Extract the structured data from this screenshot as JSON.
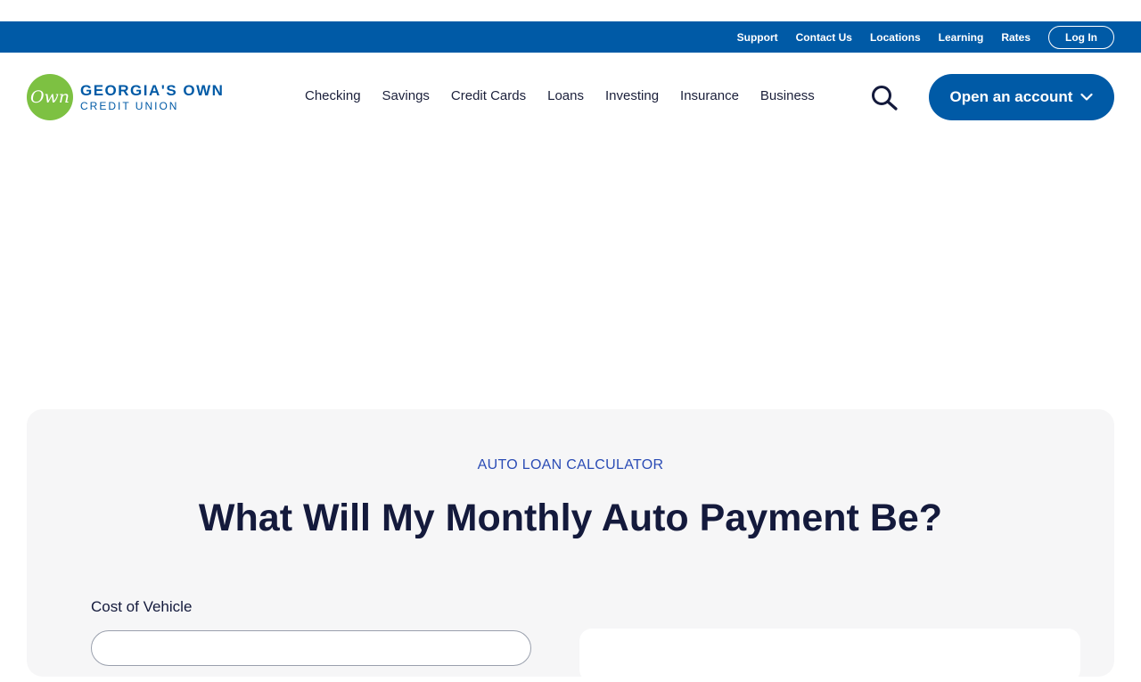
{
  "utility_nav": {
    "links": [
      "Support",
      "Contact Us",
      "Locations",
      "Learning",
      "Rates"
    ],
    "login_label": "Log In"
  },
  "brand": {
    "logo_mark": "Own",
    "name_line1": "GEORGIA'S OWN",
    "name_line2": "CREDIT UNION",
    "colors": {
      "primary": "#005aa6",
      "logo_green": "#7dc142",
      "heading": "#141a3c",
      "eyebrow": "#2b4cb5"
    }
  },
  "main_nav": {
    "items": [
      "Checking",
      "Savings",
      "Credit Cards",
      "Loans",
      "Investing",
      "Insurance",
      "Business"
    ],
    "search_icon": "search-icon",
    "cta_label": "Open an account",
    "cta_icon": "chevron-down-icon"
  },
  "calculator": {
    "eyebrow": "AUTO LOAN CALCULATOR",
    "title": "What Will My Monthly Auto Payment Be?",
    "cost_label": "Cost of Vehicle",
    "cost_value": ""
  }
}
